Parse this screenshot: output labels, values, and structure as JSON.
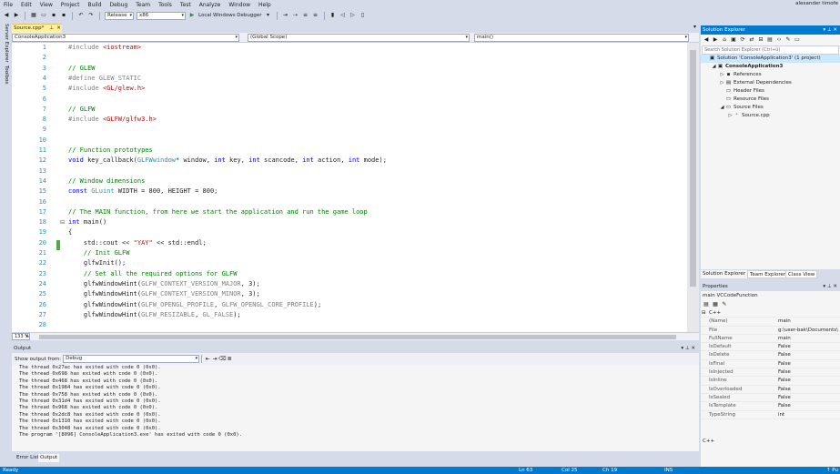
{
  "menu": {
    "items": [
      "File",
      "Edit",
      "View",
      "Project",
      "Build",
      "Debug",
      "Team",
      "Tools",
      "Test",
      "Analyze",
      "Window",
      "Help"
    ],
    "user": "alexander timofe"
  },
  "toolbar": {
    "config": "Release",
    "platform": "x86",
    "debugger": "Local Windows Debugger"
  },
  "left_tabs": [
    "Server Explorer",
    "Toolbox"
  ],
  "doc_tab": {
    "label": "Source.cpp*",
    "pin": "⊥",
    "close": "✕"
  },
  "nav": {
    "project": "ConsoleApplication3",
    "scope": "(Global Scope)",
    "member": "main()"
  },
  "code_lines": [
    {
      "n": "1",
      "html": "<span class='pp'>#include</span> <span class='st'>&lt;iostream&gt;</span>"
    },
    {
      "n": "2",
      "html": ""
    },
    {
      "n": "3",
      "html": "<span class='cm'>// GLEW</span>"
    },
    {
      "n": "4",
      "html": "<span class='pp'>#define</span> <span class='pp'>GLEW_STATIC</span>"
    },
    {
      "n": "5",
      "html": "<span class='pp'>#include</span> <span class='st'>&lt;GL/glew.h&gt;</span>"
    },
    {
      "n": "6",
      "html": ""
    },
    {
      "n": "7",
      "html": "<span class='cm'>// GLFW</span>"
    },
    {
      "n": "8",
      "html": "<span class='pp'>#include</span> <span class='st'>&lt;GLFW/glfw3.h&gt;</span>"
    },
    {
      "n": "9",
      "html": ""
    },
    {
      "n": "10",
      "html": ""
    },
    {
      "n": "11",
      "html": "<span class='cm'>// Function prototypes</span>"
    },
    {
      "n": "12",
      "html": "<span class='kw'>void</span> key_callback(<span class='ty'>GLFWwindow</span>* window, <span class='kw'>int</span> key, <span class='kw'>int</span> scancode, <span class='kw'>int</span> action, <span class='kw'>int</span> mode);"
    },
    {
      "n": "13",
      "html": ""
    },
    {
      "n": "14",
      "html": "<span class='cm'>// Window dimensions</span>"
    },
    {
      "n": "15",
      "html": "<span class='kw'>const</span> <span class='ty'>GLuint</span> WIDTH = 800, HEIGHT = 800;"
    },
    {
      "n": "16",
      "html": ""
    },
    {
      "n": "17",
      "html": "<span class='cm'>// The MAIN function, from here we start the application and run the game loop</span>"
    },
    {
      "n": "18",
      "html": "<span class='kw'>int</span> main()"
    },
    {
      "n": "19",
      "html": "{"
    },
    {
      "n": "20",
      "html": "    std::cout &lt;&lt; <span class='st'>\"YAY\"</span> &lt;&lt; std::endl;"
    },
    {
      "n": "21",
      "html": "    <span class='cm'>// Init GLFW</span>"
    },
    {
      "n": "22",
      "html": "    glfwInit();"
    },
    {
      "n": "23",
      "html": "    <span class='cm'>// Set all the required options for GLFW</span>"
    },
    {
      "n": "24",
      "html": "    glfwWindowHint(<span class='pp'>GLFW_CONTEXT_VERSION_MAJOR</span>, 3);"
    },
    {
      "n": "25",
      "html": "    glfwWindowHint(<span class='pp'>GLFW_CONTEXT_VERSION_MINOR</span>, 3);"
    },
    {
      "n": "26",
      "html": "    glfwWindowHint(<span class='pp'>GLFW_OPENGL_PROFILE</span>, <span class='pp'>GLFW_OPENGL_CORE_PROFILE</span>);"
    },
    {
      "n": "27",
      "html": "    glfwWindowHint(<span class='pp'>GLFW_RESIZABLE</span>, <span class='pp'>GL_FALSE</span>);"
    },
    {
      "n": "28",
      "html": ""
    }
  ],
  "zoom": "133 %",
  "output": {
    "title": "Output",
    "show_from_label": "Show output from:",
    "source": "Debug",
    "lines": [
      "The thread 0x27ac has exited with code 0 (0x0).",
      "The thread 0x698 has exited with code 0 (0x0).",
      "The thread 0x468 has exited with code 0 (0x0).",
      "The thread 0x1984 has exited with code 0 (0x0).",
      "The thread 0x758 has exited with code 0 (0x0).",
      "The thread 0x31d4 has exited with code 0 (0x0).",
      "The thread 0x968 has exited with code 0 (0x0).",
      "The thread 0x2dc8 has exited with code 0 (0x0).",
      "The thread 0x1310 has exited with code 0 (0x0).",
      "The thread 0x3048 has exited with code 0 (0x0).",
      "The program '[8096] ConsoleApplication3.exe' has exited with code 0 (0x0)."
    ]
  },
  "bottom_tabs": [
    "Error List",
    "Output"
  ],
  "status": {
    "ready": "Ready",
    "ln": "Ln 63",
    "col": "Col 25",
    "ch": "Ch 19",
    "ins": "INS",
    "publish": "↑ Pu"
  },
  "solution_explorer": {
    "title": "Solution Explorer",
    "search_placeholder": "Search Solution Explorer (Ctrl+ü)",
    "tree": [
      {
        "indent": 0,
        "arrow": "",
        "icon": "▣",
        "label": "Solution 'ConsoleApplication3' (1 project)",
        "bold": false
      },
      {
        "indent": 1,
        "arrow": "◢",
        "icon": "▣",
        "label": "ConsoleApplication3",
        "bold": true
      },
      {
        "indent": 2,
        "arrow": "▷",
        "icon": "▪",
        "label": "References",
        "bold": false
      },
      {
        "indent": 2,
        "arrow": "▷",
        "icon": "▤",
        "label": "External Dependencies",
        "bold": false
      },
      {
        "indent": 2,
        "arrow": "",
        "icon": "▭",
        "label": "Header Files",
        "bold": false
      },
      {
        "indent": 2,
        "arrow": "",
        "icon": "▭",
        "label": "Resource Files",
        "bold": false
      },
      {
        "indent": 2,
        "arrow": "◢",
        "icon": "▭",
        "label": "Source Files",
        "bold": false
      },
      {
        "indent": 3,
        "arrow": "▷",
        "icon": "⁺",
        "label": "Source.cpp",
        "bold": false
      }
    ],
    "tabs": [
      "Solution Explorer",
      "Team Explorer",
      "Class View"
    ]
  },
  "properties": {
    "title": "Properties",
    "object": "main  VCCodeFunction",
    "category": "C++",
    "rows": [
      {
        "name": "(Name)",
        "value": "main"
      },
      {
        "name": "File",
        "value": "g:\\user-bak\\Documents\\"
      },
      {
        "name": "FullName",
        "value": "main"
      },
      {
        "name": "IsDefault",
        "value": "False"
      },
      {
        "name": "IsDelete",
        "value": "False"
      },
      {
        "name": "IsFinal",
        "value": "False"
      },
      {
        "name": "IsInjected",
        "value": "False"
      },
      {
        "name": "IsInline",
        "value": "False"
      },
      {
        "name": "IsOverloaded",
        "value": "False"
      },
      {
        "name": "IsSealed",
        "value": "False"
      },
      {
        "name": "IsTemplate",
        "value": "False"
      },
      {
        "name": "TypeString",
        "value": "int"
      }
    ],
    "footer": "C++"
  }
}
